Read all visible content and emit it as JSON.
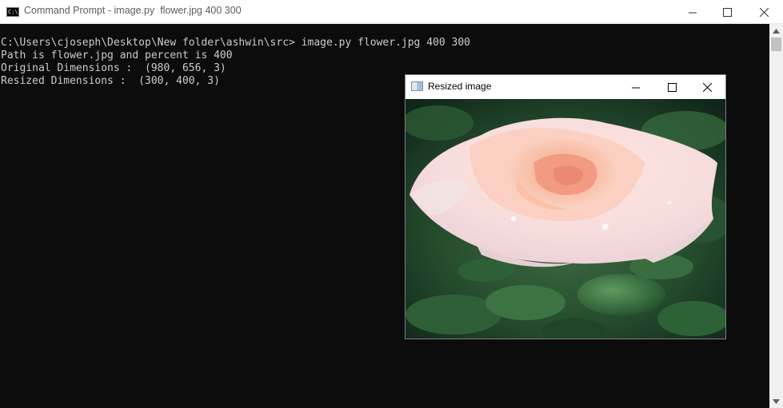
{
  "console_window": {
    "title": "Command Prompt - image.py  flower.jpg 400 300",
    "app_icon_text": "C:\\",
    "lines": [
      "C:\\Users\\cjoseph\\Desktop\\New folder\\ashwin\\src> image.py flower.jpg 400 300",
      "Path is flower.jpg and percent is 400",
      "Original Dimensions :  (980, 656, 3)",
      "Resized Dimensions :  (300, 400, 3)"
    ],
    "controls": [
      "minimize-icon",
      "maximize-icon",
      "close-icon"
    ]
  },
  "image_window": {
    "title": "Resized image",
    "controls": [
      "minimize-icon",
      "maximize-icon",
      "close-icon"
    ],
    "image": "pink-rose-photo"
  },
  "colors": {
    "console_bg": "#0c0c0c",
    "console_text": "#cccccc",
    "titlebar_bg": "#ffffff"
  }
}
